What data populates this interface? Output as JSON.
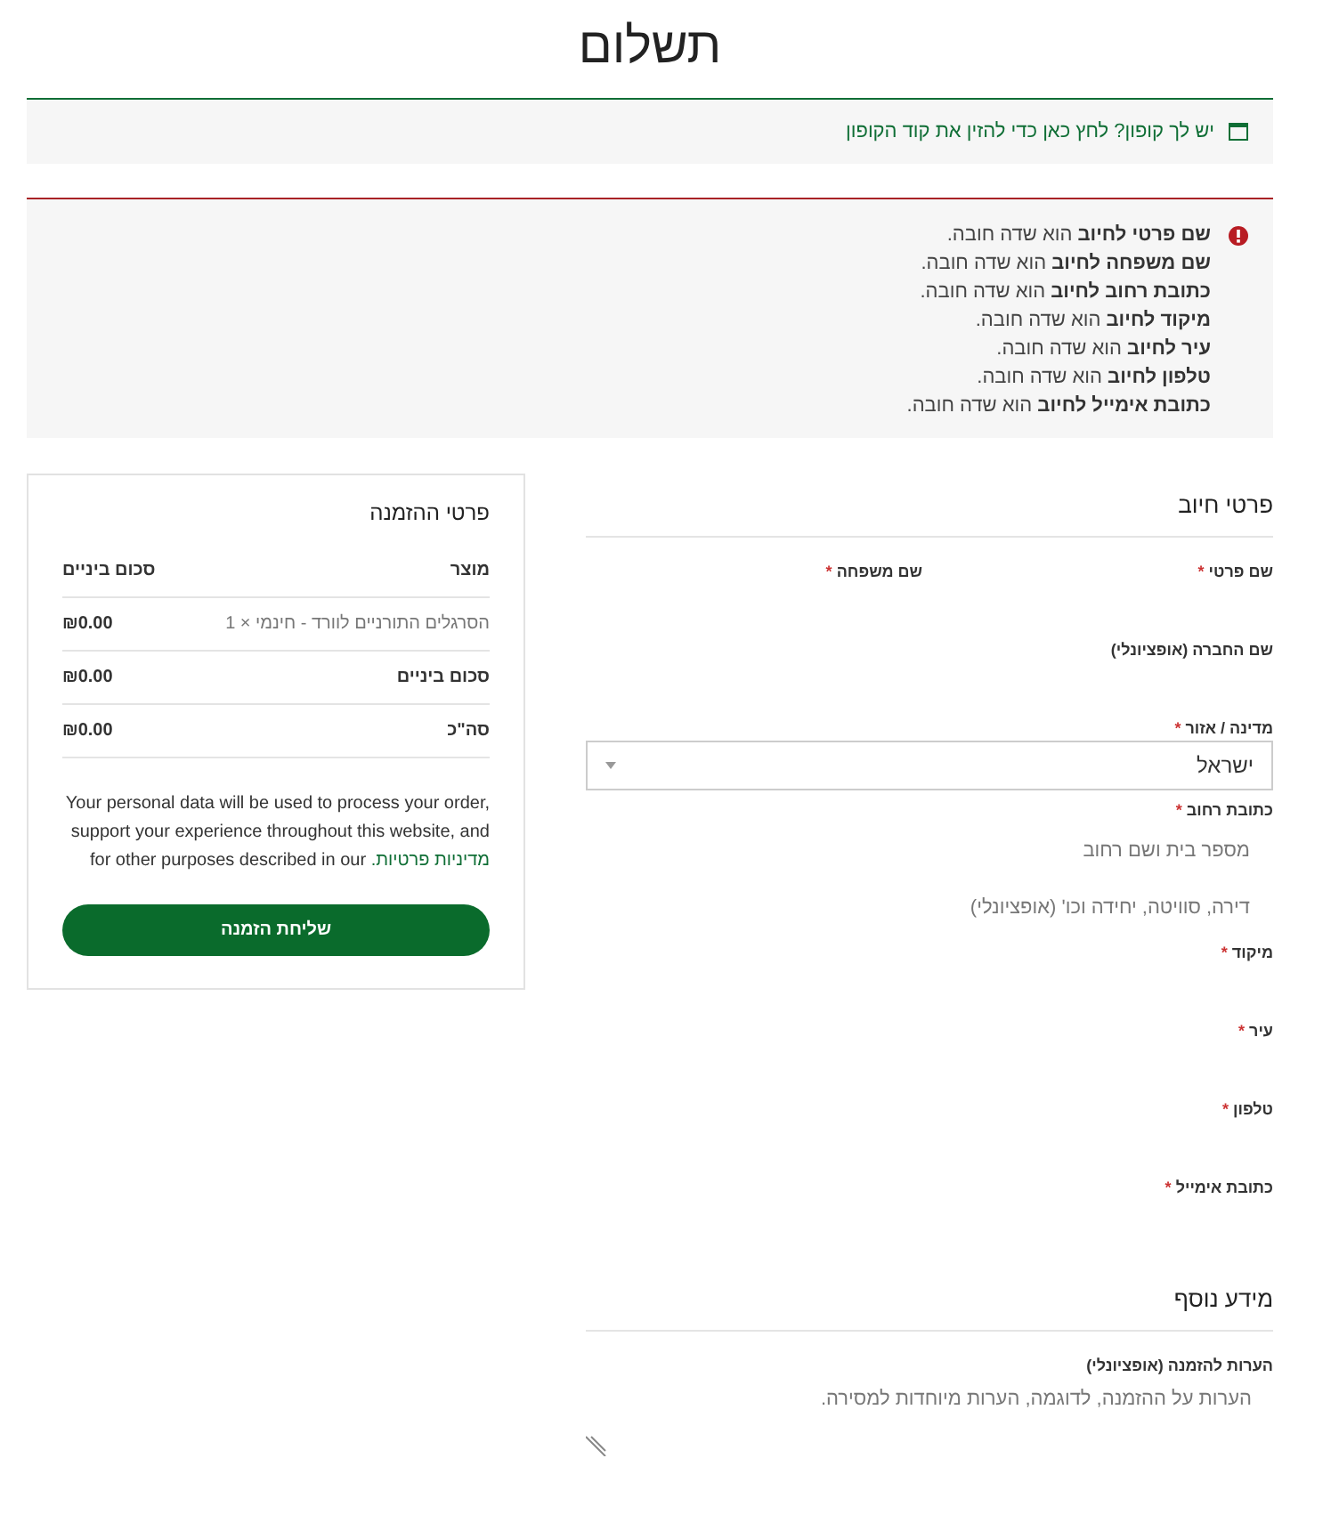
{
  "title": "תשלום",
  "required_mark": "*",
  "coupon": {
    "text": "יש לך קופון? לחץ כאן כדי להזין את קוד הקופון"
  },
  "errors": [
    "**שם פרטי לחיוב** הוא שדה חובה.",
    "**שם משפחה לחיוב** הוא שדה חובה.",
    "**כתובת רחוב לחיוב** הוא שדה חובה.",
    "**מיקוד לחיוב** הוא שדה חובה.",
    "**עיר לחיוב** הוא שדה חובה.",
    "**טלפון לחיוב** הוא שדה חובה.",
    "**כתובת אימייל לחיוב** הוא שדה חובה."
  ],
  "billing": {
    "heading": "פרטי חיוב",
    "rows": [
      [
        {
          "label": "שם פרטי",
          "required": true,
          "kind": "text"
        },
        {
          "label": "שם משפחה",
          "required": true,
          "kind": "text"
        }
      ],
      [
        {
          "label": "שם החברה (אופציונלי)",
          "required": false,
          "kind": "text"
        }
      ],
      [
        {
          "label": "מדינה / אזור",
          "required": true,
          "kind": "select",
          "value": "ישראל"
        }
      ],
      [
        {
          "label": "כתובת רחוב",
          "required": true,
          "kind": "address",
          "placeholders": [
            "מספר בית ושם רחוב",
            "דירה, סוויטה, יחידה וכו' (אופציונלי)"
          ]
        }
      ],
      [
        {
          "label": "מיקוד",
          "required": true,
          "kind": "text"
        }
      ],
      [
        {
          "label": "עיר",
          "required": true,
          "kind": "text"
        }
      ],
      [
        {
          "label": "טלפון",
          "required": true,
          "kind": "text"
        }
      ],
      [
        {
          "label": "כתובת אימייל",
          "required": true,
          "kind": "text"
        }
      ]
    ]
  },
  "additional": {
    "heading": "מידע נוסף",
    "notes": {
      "label": "הערות להזמנה (אופציונלי)",
      "placeholder": "הערות על ההזמנה, לדוגמה, הערות מיוחדות למסירה."
    }
  },
  "order": {
    "heading": "פרטי ההזמנה",
    "columns": [
      "מוצר",
      "סכום ביניים"
    ],
    "rows": [
      {
        "kind": "item",
        "label": "הסרגלים התורניים לוורד - חינמי  × 1",
        "amount": "₪0.00"
      },
      {
        "kind": "total",
        "label": "סכום ביניים",
        "amount": "₪0.00"
      },
      {
        "kind": "total",
        "label": "סה\"כ",
        "amount": "₪0.00"
      }
    ],
    "privacy_text": "Your personal data will be used to process your order, support your experience throughout this website, and for other purposes described in our",
    "privacy_link": "מדיניות פרטיות.",
    "button": "שליחת הזמנה"
  }
}
